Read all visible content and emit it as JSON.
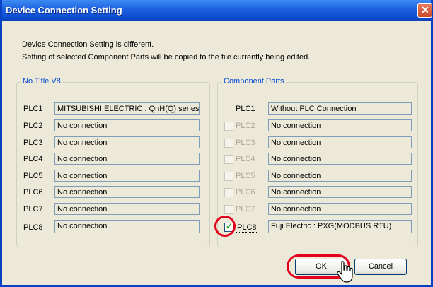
{
  "window": {
    "title": "Device Connection Setting",
    "close_glyph": "✕"
  },
  "message": {
    "line1": "Device Connection Setting is different.",
    "line2": "Setting of selected Component Parts will be copied to the file currently being edited."
  },
  "left_group": {
    "title": "No Title.V8",
    "rows": [
      {
        "label": "PLC1",
        "value": "MITSUBISHI ELECTRIC : QnH(Q) series(Et"
      },
      {
        "label": "PLC2",
        "value": "No connection"
      },
      {
        "label": "PLC3",
        "value": "No connection"
      },
      {
        "label": "PLC4",
        "value": "No connection"
      },
      {
        "label": "PLC5",
        "value": "No connection"
      },
      {
        "label": "PLC6",
        "value": "No connection"
      },
      {
        "label": "PLC7",
        "value": "No connection"
      },
      {
        "label": "PLC8",
        "value": "No connection"
      }
    ]
  },
  "right_group": {
    "title": "Component Parts",
    "rows": [
      {
        "label": "PLC1",
        "value": "Without PLC Connection"
      },
      {
        "label": "PLC2",
        "value": "No connection",
        "checked": false
      },
      {
        "label": "PLC3",
        "value": "No connection",
        "checked": false
      },
      {
        "label": "PLC4",
        "value": "No connection",
        "checked": false
      },
      {
        "label": "PLC5",
        "value": "No connection",
        "checked": false
      },
      {
        "label": "PLC6",
        "value": "No connection",
        "checked": false
      },
      {
        "label": "PLC7",
        "value": "No connection",
        "checked": false
      },
      {
        "label": "PLC8",
        "value": "Fuji Electric : PXG(MODBUS RTU)",
        "checked": true
      }
    ]
  },
  "buttons": {
    "ok": "OK",
    "cancel": "Cancel"
  },
  "colors": {
    "highlight": "#e4001c",
    "titlebar": "#0e4fd1",
    "group_title": "#0046d5"
  }
}
